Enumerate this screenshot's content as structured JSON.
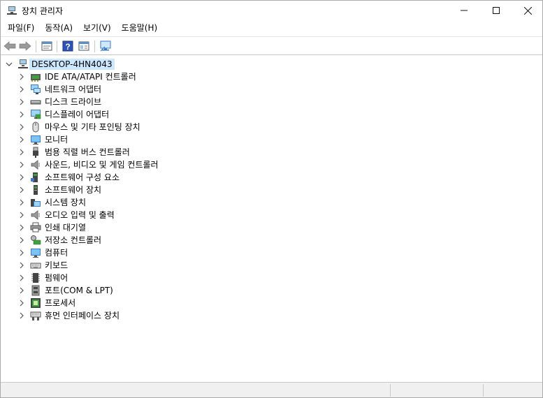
{
  "window": {
    "title": "장치 관리자"
  },
  "window_controls": {
    "minimize": "—",
    "maximize": "☐",
    "close": "✕"
  },
  "menu": [
    "파일(F)",
    "동작(A)",
    "보기(V)",
    "도움말(H)"
  ],
  "toolbar_icons": [
    "back-arrow-icon",
    "forward-arrow-icon",
    "properties-icon",
    "help-icon",
    "view-icon",
    "monitor-icon"
  ],
  "tree": {
    "root": "DESKTOP-4HN4043",
    "items": [
      {
        "label": "IDE ATA/ATAPI 컨트롤러",
        "icon": "ide-controller-icon"
      },
      {
        "label": "네트워크 어댑터",
        "icon": "network-adapter-icon"
      },
      {
        "label": "디스크 드라이브",
        "icon": "disk-drive-icon"
      },
      {
        "label": "디스플레이 어댑터",
        "icon": "display-adapter-icon"
      },
      {
        "label": "마우스 및 기타 포인팅 장치",
        "icon": "mouse-icon"
      },
      {
        "label": "모니터",
        "icon": "monitor-icon"
      },
      {
        "label": "범용 직렬 버스 컨트롤러",
        "icon": "usb-icon"
      },
      {
        "label": "사운드, 비디오 및 게임 컨트롤러",
        "icon": "speaker-icon"
      },
      {
        "label": "소프트웨어 구성 요소",
        "icon": "software-component-icon"
      },
      {
        "label": "소프트웨어 장치",
        "icon": "software-device-icon"
      },
      {
        "label": "시스템 장치",
        "icon": "system-device-icon"
      },
      {
        "label": "오디오 입력 및 출력",
        "icon": "audio-io-icon"
      },
      {
        "label": "인쇄 대기열",
        "icon": "printer-icon"
      },
      {
        "label": "저장소 컨트롤러",
        "icon": "storage-controller-icon"
      },
      {
        "label": "컴퓨터",
        "icon": "computer-icon"
      },
      {
        "label": "키보드",
        "icon": "keyboard-icon"
      },
      {
        "label": "펌웨어",
        "icon": "firmware-icon"
      },
      {
        "label": "포트(COM & LPT)",
        "icon": "port-icon"
      },
      {
        "label": "프로세서",
        "icon": "processor-icon"
      },
      {
        "label": "휴먼 인터페이스 장치",
        "icon": "hid-icon"
      }
    ]
  },
  "status_bar": {
    "text": ""
  }
}
